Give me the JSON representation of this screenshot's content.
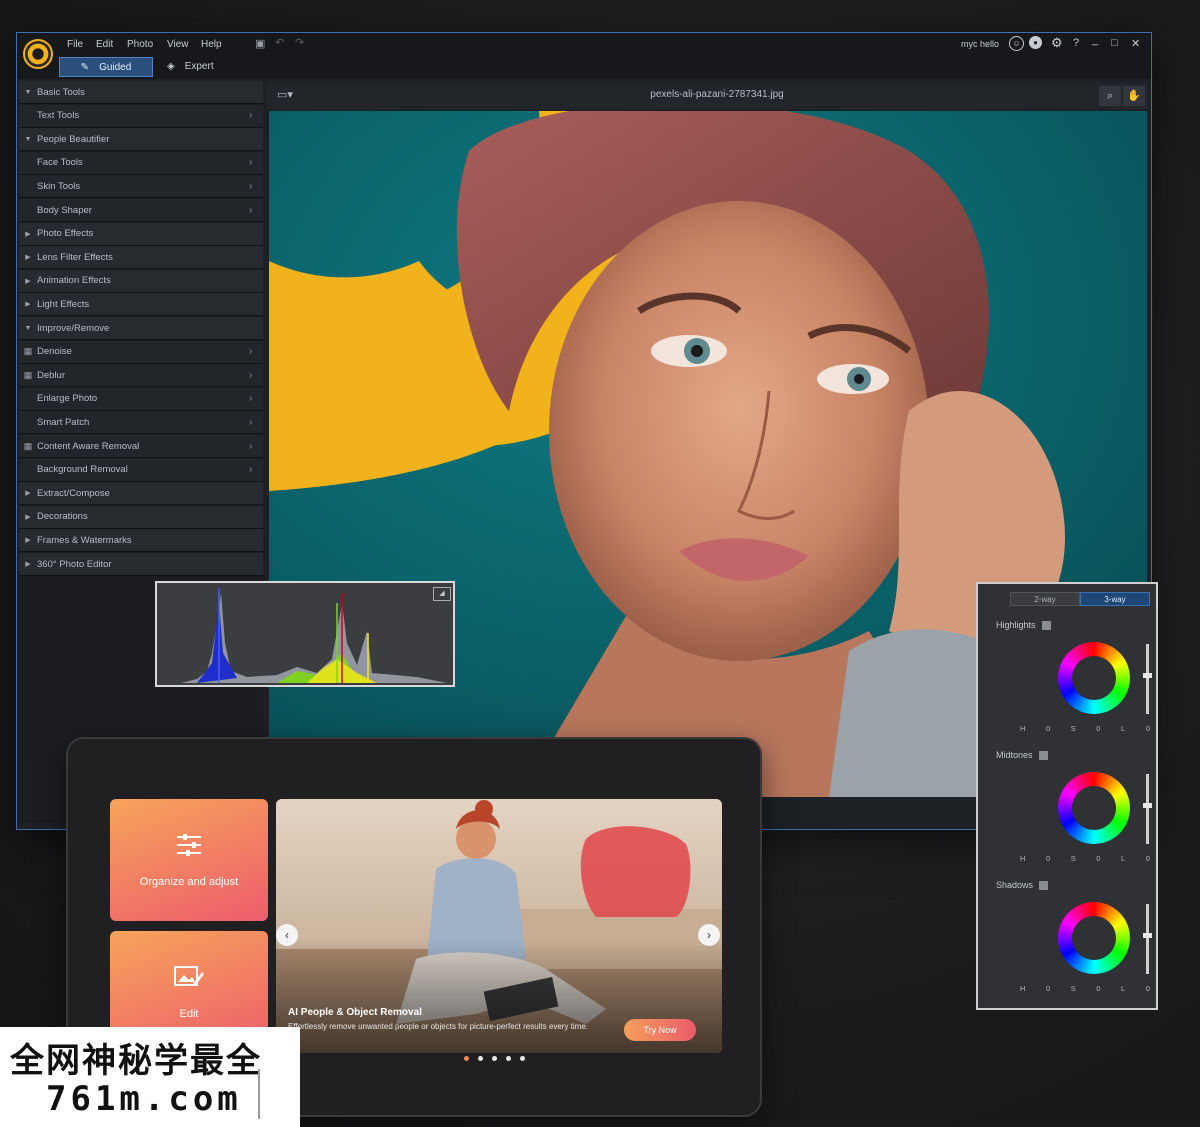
{
  "menu": [
    "File",
    "Edit",
    "Photo",
    "View",
    "Help"
  ],
  "modes": {
    "guided": "Guided",
    "expert": "Expert"
  },
  "user": "myc hello",
  "window_controls": [
    "?",
    "_",
    "□",
    "✕"
  ],
  "sidebar": {
    "items": [
      {
        "type": "cat",
        "state": "open",
        "label": "Basic Tools"
      },
      {
        "type": "sub",
        "label": "Text Tools",
        "chevron": true
      },
      {
        "type": "cat",
        "state": "open",
        "label": "People Beautifier"
      },
      {
        "type": "sub",
        "label": "Face Tools",
        "chevron": true
      },
      {
        "type": "sub",
        "label": "Skin Tools",
        "chevron": true
      },
      {
        "type": "sub",
        "label": "Body Shaper",
        "chevron": true
      },
      {
        "type": "cat",
        "state": "closed",
        "label": "Photo Effects"
      },
      {
        "type": "cat",
        "state": "closed",
        "label": "Lens Filter Effects"
      },
      {
        "type": "cat",
        "state": "closed",
        "label": "Animation Effects"
      },
      {
        "type": "cat",
        "state": "closed",
        "label": "Light Effects"
      },
      {
        "type": "cat",
        "state": "open",
        "label": "Improve/Remove"
      },
      {
        "type": "sub",
        "label": "Denoise",
        "chevron": true,
        "ai": true
      },
      {
        "type": "sub",
        "label": "Deblur",
        "chevron": true,
        "ai": true
      },
      {
        "type": "sub",
        "label": "Enlarge Photo",
        "chevron": true
      },
      {
        "type": "sub",
        "label": "Smart Patch",
        "chevron": true
      },
      {
        "type": "sub",
        "label": "Content Aware Removal",
        "chevron": true,
        "ai": true
      },
      {
        "type": "sub",
        "label": "Background Removal",
        "chevron": true
      },
      {
        "type": "cat",
        "state": "closed",
        "label": "Extract/Compose"
      },
      {
        "type": "cat",
        "state": "closed",
        "label": "Decorations"
      },
      {
        "type": "cat",
        "state": "closed",
        "label": "Frames & Watermarks"
      },
      {
        "type": "cat",
        "state": "closed",
        "label": "360° Photo Editor"
      }
    ]
  },
  "canvas": {
    "filename": "pexels-ali-pazani-2787341.jpg"
  },
  "color_panel": {
    "tabs": [
      "2-way",
      "3-way"
    ],
    "active_tab": 1,
    "groups": [
      {
        "label": "Highlights",
        "h": "0",
        "s": "0",
        "l": "0",
        "slider": 0.45
      },
      {
        "label": "Midtones",
        "h": "0",
        "s": "0",
        "l": "0",
        "slider": 0.45
      },
      {
        "label": "Shadows",
        "h": "0",
        "s": "0",
        "l": "0",
        "slider": 0.45
      }
    ],
    "hsl_labels": {
      "h": "H",
      "s": "S",
      "l": "L"
    }
  },
  "tablet": {
    "tiles": [
      {
        "label": "Organize and adjust",
        "icon": "sliders-icon"
      },
      {
        "label": "Edit",
        "icon": "image-edit-icon"
      }
    ],
    "banner": {
      "title": "AI People & Object Removal",
      "desc": "Effortlessly remove unwanted people or objects for picture-perfect results every time.",
      "cta": "Try Now"
    },
    "dots": 5,
    "active_dot": 0
  },
  "watermark": {
    "line1": "全网神秘学最全",
    "line2": "761m.com"
  },
  "colors": {
    "accent": "#3a6fb0",
    "guided": "#2a4f7c",
    "brand_yellow": "#f2b21b",
    "tile_from": "#f6a45b",
    "tile_to": "#ee5d6c",
    "teal": "#0e6b72"
  }
}
